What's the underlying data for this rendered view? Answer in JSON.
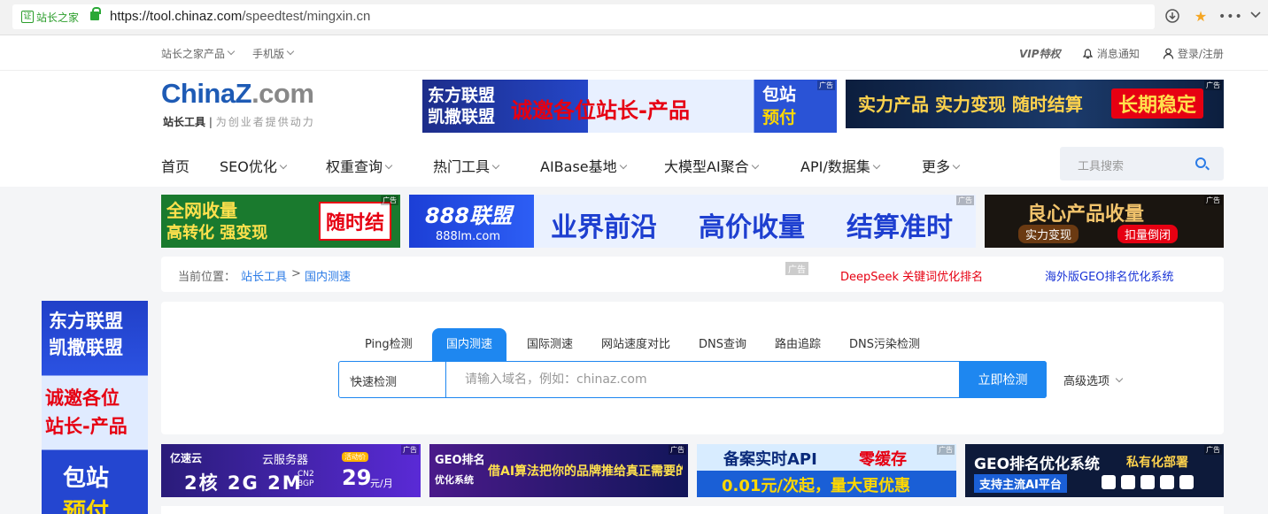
{
  "browser": {
    "cert_label": "站长之家",
    "cert_badge": "证",
    "url_host": "https://tool.chinaz.com",
    "url_path": "/speedtest/mingxin.cn"
  },
  "topnav": {
    "products": "站长之家产品",
    "mobile": "手机版",
    "vip": "VIP特权",
    "notifications": "消息通知",
    "login": "登录/注册"
  },
  "logo": {
    "brand_a": "China",
    "brand_z": "Z",
    "brand_b": ".com",
    "tag": "站长工具",
    "slogan": "为创业者提供动力"
  },
  "ads": {
    "flag": "广告",
    "top1_left_a": "东方联盟",
    "top1_left_b": "凯撒联盟",
    "top1_mid": "诚邀各位站长-产品",
    "top1_right_a": "包站",
    "top1_right_b": "预付",
    "top2": "实力产品 实力变现 随时结算",
    "top2_right": "长期稳定",
    "row2_1a": "全网收量",
    "row2_1b": "高转化 强变现",
    "row2_1c": "随时结",
    "row2_2a": "888联盟",
    "row2_2b": "888lm.com",
    "row2_2c": "业界前沿",
    "row2_2d": "高价收量",
    "row2_2e": "结算准时",
    "row2_3a": "良心产品收量",
    "row2_3b": "实力变现",
    "row2_3c": "扣量倒闭",
    "side_a": "东方联盟",
    "side_b": "凯撒联盟",
    "side_c": "诚邀各位",
    "side_d": "站长-产品",
    "side_e": "包站",
    "side_f": "预付",
    "b1_brand": "亿速云",
    "b1_title": "云服务器",
    "b1_spec": "2核 2G 2M",
    "b1_net": "CN2",
    "b1_bgp": "BGP",
    "b1_badge": "活动价",
    "b1_price": "29",
    "b1_unit": "元/月",
    "b2_a": "GEO排名",
    "b2_b": "优化系统",
    "b2_c": "借AI算法把你的品牌推给真正需要的客户",
    "b3_a": "备案实时API",
    "b3_b": "零缓存",
    "b3_c": "0.01元/次起，量大更优惠",
    "b4_a": "GEO排名优化系统",
    "b4_b": "私有化部署",
    "b4_c": "支持主流AI平台"
  },
  "mainnav": [
    "首页",
    "SEO优化",
    "权重查询",
    "热门工具",
    "AIBase基地",
    "大模型AI聚合",
    "API/数据集",
    "更多"
  ],
  "tool_search": {
    "placeholder": "工具搜索"
  },
  "breadcrumb": {
    "label": "当前位置：",
    "home": "站长工具",
    "sep": ">",
    "current": "国内测速",
    "ad_flag": "广告",
    "link1": "DeepSeek 关键词优化排名",
    "link2": "海外版GEO排名优化系统"
  },
  "tabs": [
    "Ping检测",
    "国内测速",
    "国际测速",
    "网站速度对比",
    "DNS查询",
    "路由追踪",
    "DNS污染检测"
  ],
  "active_tab": "国内测速",
  "form": {
    "mode": "快速检测",
    "placeholder": "请输入域名，例如：chinaz.com",
    "submit": "立即检测",
    "advanced": "高级选项"
  },
  "colors": {
    "accent": "#1e87f0",
    "link_red": "#e60012",
    "link_blue": "#1a34d6"
  }
}
